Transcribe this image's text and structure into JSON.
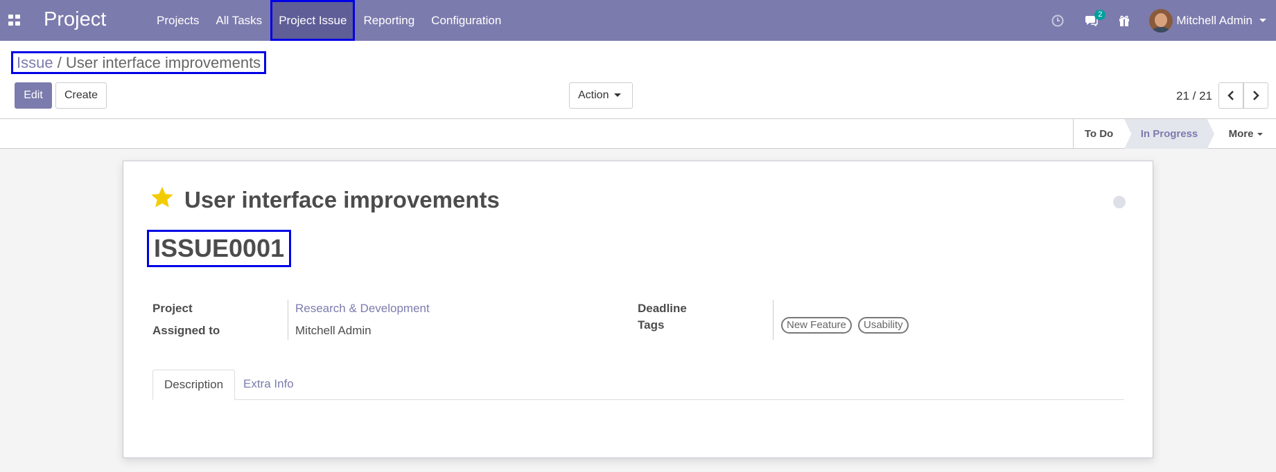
{
  "navbar": {
    "app_title": "Project",
    "menu": [
      {
        "label": "Projects"
      },
      {
        "label": "All Tasks"
      },
      {
        "label": "Project Issue"
      },
      {
        "label": "Reporting"
      },
      {
        "label": "Configuration"
      }
    ],
    "messages_count": "2",
    "user_name": "Mitchell Admin"
  },
  "control_panel": {
    "breadcrumb_parent": "Issue",
    "breadcrumb_separator": "/",
    "breadcrumb_current": "User interface improvements",
    "edit_label": "Edit",
    "create_label": "Create",
    "action_label": "Action",
    "pager_text": "21 / 21"
  },
  "statusbar": {
    "stages": [
      {
        "label": "To Do"
      },
      {
        "label": "In Progress"
      }
    ],
    "more_label": "More",
    "active_stage": "In Progress"
  },
  "form": {
    "title": "User interface improvements",
    "issue_code": "ISSUE0001",
    "starred": true,
    "project_label": "Project",
    "project_value": "Research & Development",
    "assigned_label": "Assigned to",
    "assigned_value": "Mitchell Admin",
    "deadline_label": "Deadline",
    "deadline_value": "",
    "tags_label": "Tags",
    "tags": [
      "New Feature",
      "Usability"
    ],
    "tabs": [
      {
        "label": "Description"
      },
      {
        "label": "Extra Info"
      }
    ]
  },
  "colors": {
    "brand": "#7c7bad",
    "highlight_outline": "#0000e6",
    "star": "#f3cc00",
    "badge": "#00a09d"
  },
  "icons": [
    "apps-icon",
    "clock-icon",
    "chat-icon",
    "gift-icon",
    "chevron-left-icon",
    "chevron-right-icon",
    "star-icon"
  ]
}
